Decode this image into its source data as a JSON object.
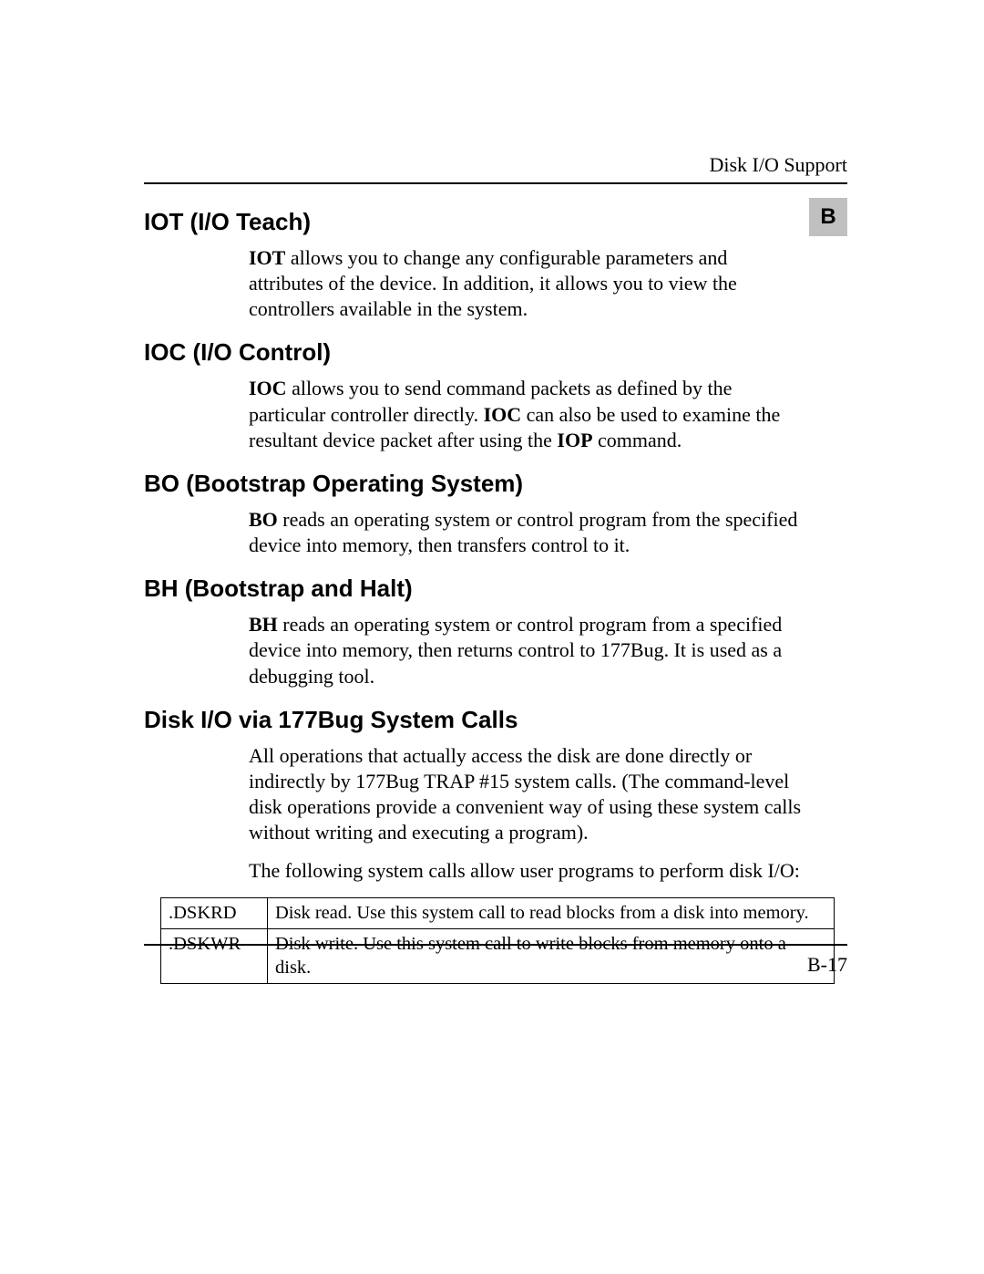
{
  "header": {
    "running_title": "Disk I/O Support",
    "tab_letter": "B"
  },
  "sections": {
    "iot": {
      "heading": "IOT (I/O Teach)",
      "para_lead_bold": "IOT",
      "para_rest": " allows you to change any configurable parameters and attributes of the device. In addition, it allows you to view the controllers available in the system."
    },
    "ioc": {
      "heading": "IOC (I/O Control)",
      "lead_bold": "IOC",
      "text_1": " allows you to send command packets as defined by the particular controller directly. ",
      "mid_bold": "IOC",
      "text_2": " can also be used to examine the resultant device packet after using the ",
      "tail_bold": "IOP",
      "text_3": " command."
    },
    "bo": {
      "heading": "BO (Bootstrap Operating System)",
      "lead_bold": "BO",
      "text": " reads an operating system or control program from the specified device into memory, then transfers control to it."
    },
    "bh": {
      "heading": "BH (Bootstrap and Halt)",
      "lead_bold": "BH",
      "text": " reads an operating system or control program from a specified device into memory, then returns control to 177Bug. It is used as a debugging tool."
    },
    "diskio": {
      "heading": "Disk I/O via 177Bug System Calls",
      "para1": "All operations that actually access the disk are done directly or indirectly by 177Bug TRAP #15 system calls. (The command-level disk operations provide a convenient way of using these system calls without writing and executing a program).",
      "para2": "The following system calls allow user programs to perform disk I/O:"
    }
  },
  "syscall_table": [
    {
      "name": ".DSKRD",
      "desc": "Disk read. Use this system call to read blocks from a disk into memory."
    },
    {
      "name": ".DSKWR",
      "desc": "Disk write. Use this system call to write blocks from memory onto a disk."
    }
  ],
  "footer": {
    "page_number": "B-17"
  }
}
